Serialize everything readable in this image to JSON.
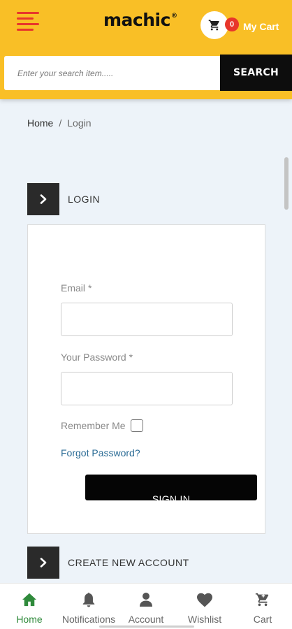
{
  "header": {
    "logo_text": "machic",
    "logo_mark": "®",
    "cart_count": "0",
    "cart_label": "My Cart",
    "menu_icon": "hamburger-icon",
    "cart_icon": "cart-icon",
    "colors": {
      "header_bg": "#f9bf26",
      "accent_red": "#e8362b"
    }
  },
  "search": {
    "placeholder": "Enter your search item.....",
    "button_label": "SEARCH"
  },
  "breadcrumb": {
    "home": "Home",
    "separator": "/",
    "current": "Login"
  },
  "login": {
    "section_title": "LOGIN",
    "email_label": "Email",
    "email_required": "*",
    "email_value": "",
    "password_label": "Your Password",
    "password_required": "*",
    "password_value": "",
    "remember_label": "Remember Me",
    "remember_checked": false,
    "forgot_link": "Forgot Password?",
    "signin_button": "SIGN IN"
  },
  "register": {
    "section_title": "CREATE NEW ACCOUNT"
  },
  "bottom_nav": {
    "items": [
      {
        "label": "Home",
        "icon": "home-icon",
        "active": true
      },
      {
        "label": "Notifications",
        "icon": "bell-icon",
        "active": false
      },
      {
        "label": "Account",
        "icon": "user-icon",
        "active": false
      },
      {
        "label": "Wishlist",
        "icon": "heart-icon",
        "active": false
      },
      {
        "label": "Cart",
        "icon": "cart-icon",
        "active": false
      }
    ],
    "active_color": "#2f8a3b"
  }
}
